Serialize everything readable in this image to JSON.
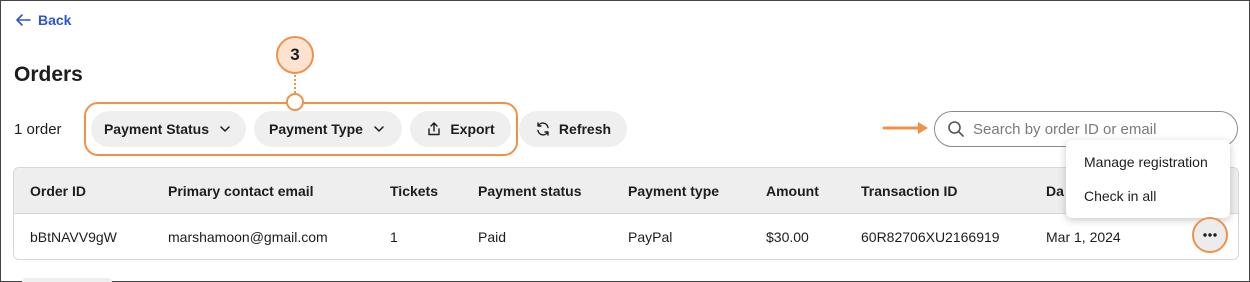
{
  "nav": {
    "back_label": "Back"
  },
  "page": {
    "title": "Orders",
    "order_count": "1 order"
  },
  "toolbar": {
    "payment_status_label": "Payment Status",
    "payment_type_label": "Payment Type",
    "export_label": "Export",
    "refresh_label": "Refresh"
  },
  "callout": {
    "number": "3",
    "color": "#f0914b"
  },
  "search": {
    "placeholder": "Search by order ID or email",
    "value": ""
  },
  "table": {
    "columns": [
      "Order ID",
      "Primary contact email",
      "Tickets",
      "Payment status",
      "Payment type",
      "Amount",
      "Transaction ID",
      "Da"
    ],
    "rows": [
      [
        "bBtNAVV9gW",
        "marshamoon@gmail.com",
        "1",
        "Paid",
        "PayPal",
        "$30.00",
        "60R82706XU2166919",
        "Mar 1, 2024"
      ]
    ]
  },
  "row_menu": {
    "items": [
      "Manage registration",
      "Check in all"
    ]
  },
  "icons": {
    "back": "arrow-left-icon",
    "dropdown": "chevron-down-icon",
    "export": "upload-icon",
    "refresh": "refresh-icon",
    "search": "search-icon",
    "more": "more-icon",
    "pointer": "arrow-right-icon"
  },
  "colors": {
    "accent": "#2b55d6",
    "highlight": "#f0914b",
    "highlight_fill": "#fbe3cf"
  }
}
